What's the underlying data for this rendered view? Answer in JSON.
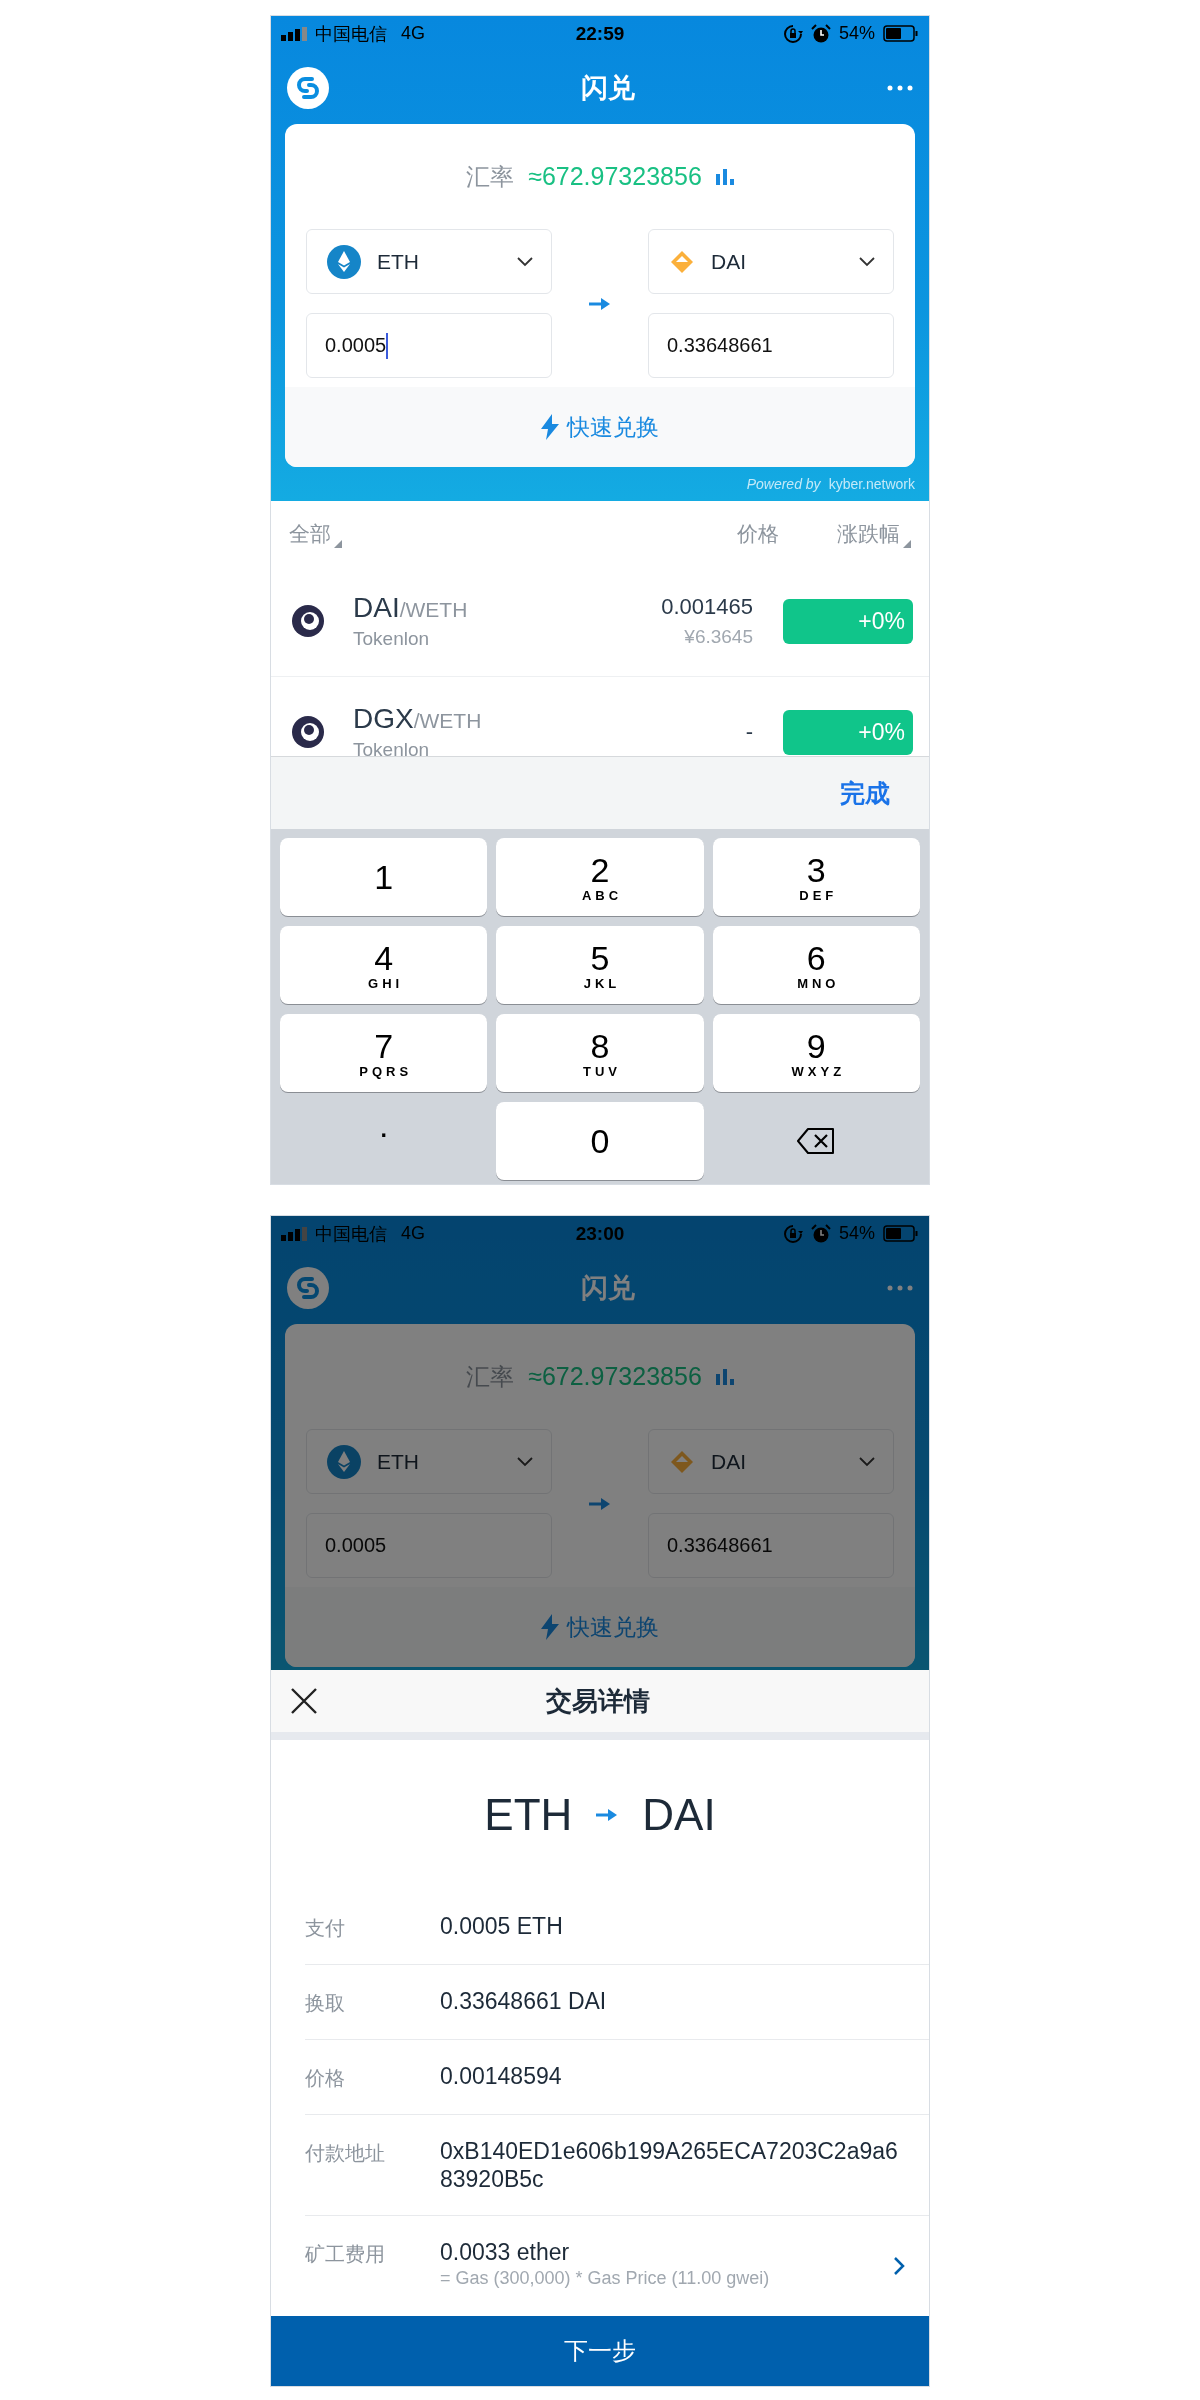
{
  "screens": [
    {
      "dimmed": false,
      "status_bar": {
        "carrier": "中国电信",
        "network": "4G",
        "time": "22:59",
        "battery": "54%"
      },
      "header": {
        "title": "闪兑"
      },
      "exchange_card": {
        "rate_label": "汇率",
        "rate_value": "≈672.97323856",
        "from_token": "ETH",
        "to_token": "DAI",
        "from_amount": "0.0005",
        "from_focused": true,
        "to_amount": "0.33648661",
        "action": "快速兑换"
      },
      "powered_by": {
        "prefix": "Powered by",
        "brand": "kyber.network"
      },
      "market_list": {
        "columns": [
          {
            "label": "全部",
            "sortable": true
          },
          {
            "label": "价格",
            "sortable": false
          },
          {
            "label": "涨跌幅",
            "sortable": true
          }
        ],
        "rows": [
          {
            "base": "DAI",
            "quote": "/WETH",
            "exchange": "Tokenlon",
            "price": "0.001465",
            "price_cny": "¥6.3645",
            "change": "+0%"
          },
          {
            "base": "DGX",
            "quote": "/WETH",
            "exchange": "Tokenlon",
            "price": "-",
            "change": "+0%"
          }
        ]
      },
      "keyboard": {
        "done": "完成",
        "keys": [
          {
            "kind": "digit",
            "label": "1"
          },
          {
            "kind": "digit",
            "label": "2",
            "letters": "ABC"
          },
          {
            "kind": "digit",
            "label": "3",
            "letters": "DEF"
          },
          {
            "kind": "digit",
            "label": "4",
            "letters": "GHI"
          },
          {
            "kind": "digit",
            "label": "5",
            "letters": "JKL"
          },
          {
            "kind": "digit",
            "label": "6",
            "letters": "MNO"
          },
          {
            "kind": "digit",
            "label": "7",
            "letters": "PQRS"
          },
          {
            "kind": "digit",
            "label": "8",
            "letters": "TUV"
          },
          {
            "kind": "digit",
            "label": "9",
            "letters": "WXYZ"
          },
          {
            "kind": "symbol",
            "label": "."
          },
          {
            "kind": "digit",
            "label": "0"
          },
          {
            "kind": "delete"
          }
        ]
      }
    },
    {
      "dimmed": true,
      "status_bar": {
        "carrier": "中国电信",
        "network": "4G",
        "time": "23:00",
        "battery": "54%"
      },
      "header": {
        "title": "闪兑"
      },
      "exchange_card": {
        "rate_label": "汇率",
        "rate_value": "≈672.97323856",
        "from_token": "ETH",
        "to_token": "DAI",
        "from_amount": "0.0005",
        "from_focused": false,
        "to_amount": "0.33648661",
        "action": "快速兑换"
      },
      "detail_sheet": {
        "title": "交易详情",
        "from": "ETH",
        "to": "DAI",
        "rows": [
          {
            "label": "支付",
            "value": "0.0005 ETH",
            "link": false
          },
          {
            "label": "换取",
            "value": "0.33648661 DAI",
            "link": false
          },
          {
            "label": "价格",
            "value": "0.00148594",
            "link": false
          },
          {
            "label": "付款地址",
            "value": "0xB140ED1e606b199A265ECA7203C2a9a683920B5c",
            "link": false
          },
          {
            "label": "矿工费用",
            "value": "0.0033 ether",
            "note": "= Gas (300,000) * Gas Price (11.00 gwei)",
            "link": true
          }
        ],
        "button": "下一步"
      }
    }
  ]
}
